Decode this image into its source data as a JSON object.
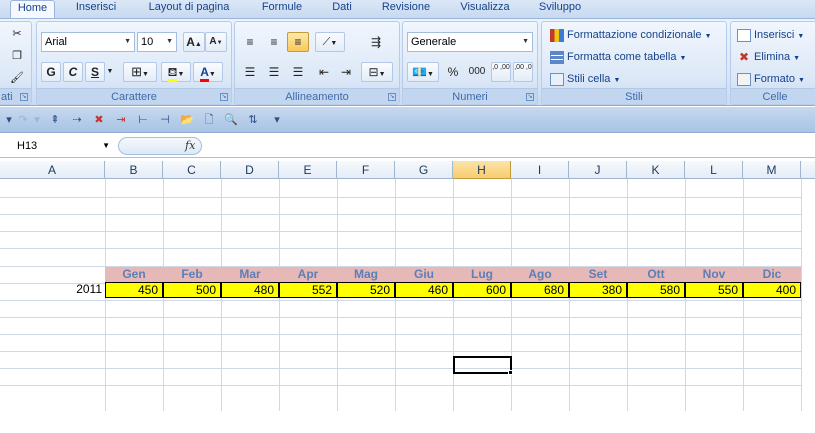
{
  "tabs": [
    "Home",
    "Inserisci",
    "Layout di pagina",
    "Formule",
    "Dati",
    "Revisione",
    "Visualizza",
    "Sviluppo"
  ],
  "ribbon": {
    "clipboard_label_partial": "ati",
    "font": {
      "name": "Arial",
      "size": "10",
      "bold": "G",
      "italic": "C",
      "underline": "S",
      "grow": "A",
      "shrink": "A",
      "group_label": "Carattere"
    },
    "alignment": {
      "group_label": "Allineamento"
    },
    "number": {
      "format": "Generale",
      "percent": "%",
      "thousands": "000",
      "inc_decimal": ",0 ,00",
      "dec_decimal": ",00 ,0",
      "group_label": "Numeri"
    },
    "styles": {
      "conditional": "Formattazione condizionale",
      "as_table": "Formatta come tabella",
      "cell_styles": "Stili cella",
      "group_label": "Stili"
    },
    "cells": {
      "insert": "Inserisci",
      "delete": "Elimina",
      "format": "Formato",
      "group_label": "Celle"
    }
  },
  "formula_bar": {
    "name_box": "H13",
    "fx": "fx",
    "formula": ""
  },
  "columns": [
    "A",
    "B",
    "C",
    "D",
    "E",
    "F",
    "G",
    "H",
    "I",
    "J",
    "K",
    "L",
    "M"
  ],
  "selected_column": "H",
  "sheet": {
    "months": [
      "Gen",
      "Feb",
      "Mar",
      "Apr",
      "Mag",
      "Giu",
      "Lug",
      "Ago",
      "Set",
      "Ott",
      "Nov",
      "Dic"
    ],
    "year": "2011",
    "values": [
      "450",
      "500",
      "480",
      "552",
      "520",
      "460",
      "600",
      "680",
      "380",
      "580",
      "550",
      "400"
    ]
  },
  "active_cell": "H13",
  "colors": {
    "header_fill": "#E6B8B8",
    "value_fill": "#FFFF00",
    "header_text": "#5B7FB6"
  }
}
